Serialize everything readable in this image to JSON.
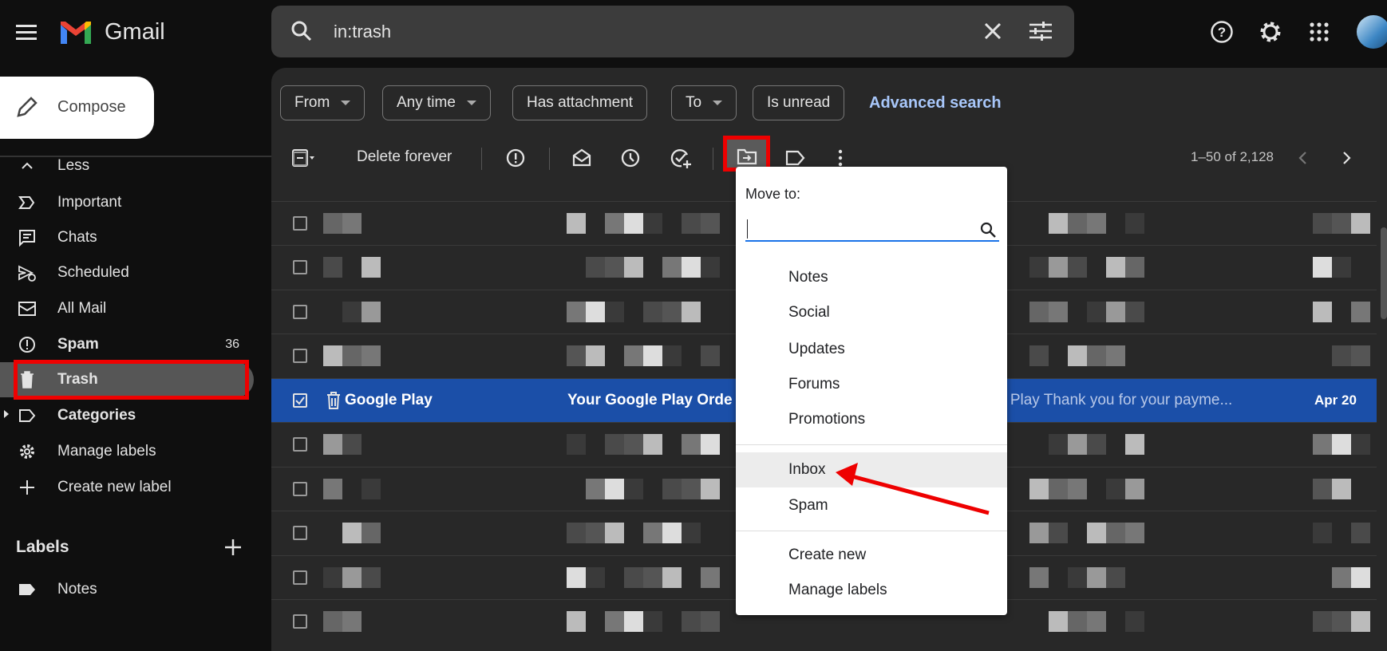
{
  "header": {
    "app_name": "Gmail",
    "search_value": "in:trash",
    "icons": [
      "menu-icon",
      "search-icon",
      "close-icon",
      "tune-icon",
      "help-icon",
      "gear-icon",
      "apps-icon",
      "avatar"
    ]
  },
  "sidebar": {
    "compose_label": "Compose",
    "items": [
      {
        "label": "Less",
        "icon": "chevron-up-icon"
      },
      {
        "label": "Important",
        "icon": "important-icon"
      },
      {
        "label": "Chats",
        "icon": "chat-icon"
      },
      {
        "label": "Scheduled",
        "icon": "scheduled-icon"
      },
      {
        "label": "All Mail",
        "icon": "all-mail-icon"
      },
      {
        "label": "Spam",
        "icon": "spam-icon",
        "count": "36",
        "bold": true
      },
      {
        "label": "Trash",
        "icon": "trash-icon",
        "bold": true,
        "active": true
      },
      {
        "label": "Categories",
        "icon": "label-icon",
        "bold": true
      },
      {
        "label": "Manage labels",
        "icon": "gear-icon"
      },
      {
        "label": "Create new label",
        "icon": "plus-icon"
      }
    ],
    "labels_heading": "Labels",
    "labels": [
      {
        "label": "Notes"
      }
    ]
  },
  "filters": {
    "from": "From",
    "any_time": "Any time",
    "has_attachment": "Has attachment",
    "to": "To",
    "is_unread": "Is unread",
    "advanced_search": "Advanced search"
  },
  "toolbar": {
    "delete_forever": "Delete forever",
    "pagination": "1–50 of 2,128"
  },
  "selected_email": {
    "sender": "Google Play",
    "subject": "Your Google Play Orde",
    "snippet": "e Play Thank you for your payme...",
    "date": "Apr 20"
  },
  "move_menu": {
    "title": "Move to:",
    "search_value": "",
    "items": [
      "Notes",
      "Social",
      "Updates",
      "Forums",
      "Promotions"
    ],
    "system_items": [
      "Inbox",
      "Spam"
    ],
    "actions": [
      "Create new",
      "Manage labels"
    ],
    "hovered": "Inbox"
  },
  "colors": {
    "highlight_red": "#e00000",
    "selected_row": "#1b4fa8",
    "link": "#a8c7fa"
  }
}
